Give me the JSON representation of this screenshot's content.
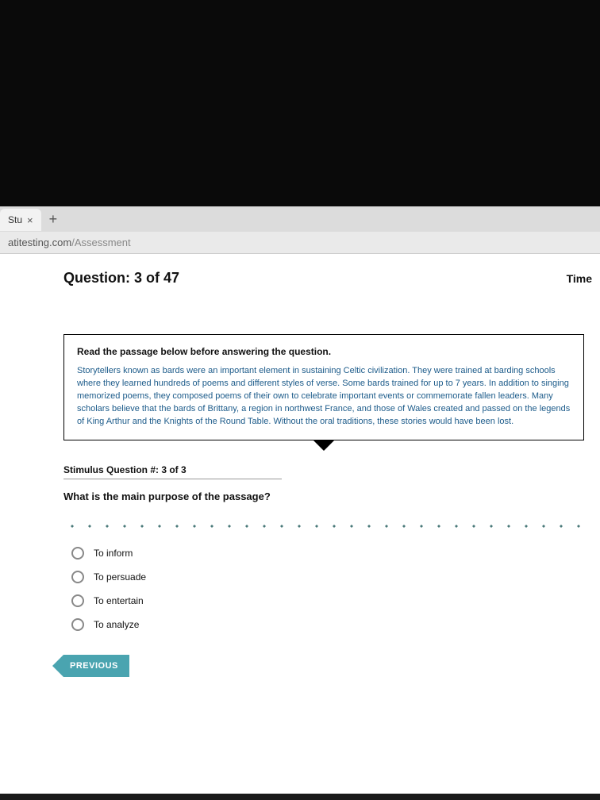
{
  "browser": {
    "tab_label": "Stu",
    "url_host": "atitesting.com",
    "url_path": "/Assessment"
  },
  "header": {
    "question_label": "Question: 3 of 47",
    "time_label": "Time"
  },
  "passage": {
    "instruction": "Read the passage below before answering the question.",
    "body": "Storytellers known as bards were an important element in sustaining Celtic civilization. They were trained at barding schools where they learned hundreds of poems and different styles of verse. Some bards trained for up to 7 years. In addition to singing memorized poems, they composed poems of their own to celebrate important events or commemorate fallen leaders. Many scholars believe that the bards of Brittany, a region in northwest France, and those of Wales created and passed on the legends of King Arthur and the Knights of the Round Table. Without the oral traditions, these stories would have been lost."
  },
  "stimulus": {
    "label": "Stimulus Question #: 3 of 3",
    "question": "What is the main purpose of the passage?"
  },
  "options": [
    {
      "label": "To inform"
    },
    {
      "label": "To persuade"
    },
    {
      "label": "To entertain"
    },
    {
      "label": "To analyze"
    }
  ],
  "buttons": {
    "previous": "PREVIOUS"
  },
  "icons": {
    "close": "×",
    "plus": "+"
  }
}
